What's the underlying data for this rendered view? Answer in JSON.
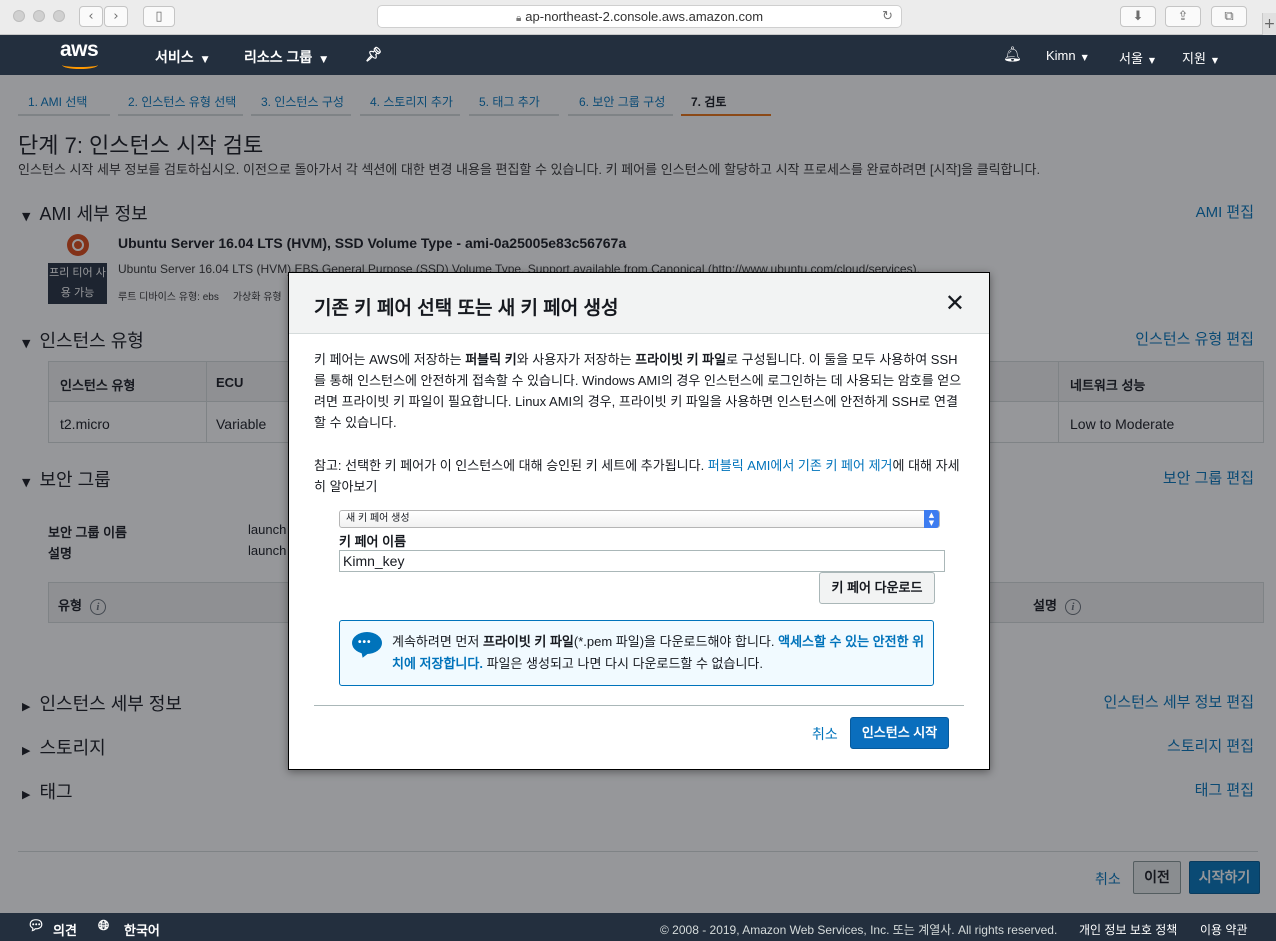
{
  "browser": {
    "url": "ap-northeast-2.console.aws.amazon.com"
  },
  "nav": {
    "logo": "aws",
    "services": "서비스",
    "resource_groups": "리소스 그룹",
    "user": "Kimn",
    "region": "서울",
    "support": "지원"
  },
  "wizard": {
    "tabs": [
      "1. AMI 선택",
      "2. 인스턴스 유형 선택",
      "3. 인스턴스 구성",
      "4. 스토리지 추가",
      "5. 태그 추가",
      "6. 보안 그룹 구성",
      "7. 검토"
    ],
    "active_tab": "7. 검토"
  },
  "page": {
    "title": "단계 7: 인스턴스 시작 검토",
    "description": "인스턴스 시작 세부 정보를 검토하십시오. 이전으로 돌아가서 각 섹션에 대한 변경 내용을 편집할 수 있습니다. 키 페어를 인스턴스에 할당하고 시작 프로세스를 완료하려면 [시작]을 클릭합니다."
  },
  "ami": {
    "heading": "AMI 세부 정보",
    "edit": "AMI 편집",
    "free_badge_1": "프리 티어 사",
    "free_badge_2": "용 가능",
    "title": "Ubuntu Server 16.04 LTS (HVM), SSD Volume Type - ami-0a25005e83c56767a",
    "desc": "Ubuntu Server 16.04 LTS (HVM),EBS General Purpose (SSD) Volume Type. Support available from Canonical (http://www.ubuntu.com/cloud/services).",
    "meta_root": "루트 디바이스 유형: ebs",
    "meta_virt": "가상화 유형"
  },
  "instance_type": {
    "heading": "인스턴스 유형",
    "edit": "인스턴스 유형 편집",
    "col_type": "인스턴스 유형",
    "col_ecu": "ECU",
    "col_network": "네트워크 성능",
    "row_type": "t2.micro",
    "row_ecu": "Variable",
    "row_network": "Low to Moderate"
  },
  "security_group": {
    "heading": "보안 그룹",
    "edit": "보안 그룹 편집",
    "name_label": "보안 그룹 이름",
    "desc_label": "설명",
    "name_value": "launch",
    "desc_value": "launch",
    "col_type": "유형",
    "col_desc": "설명"
  },
  "instance_details": {
    "heading": "인스턴스 세부 정보",
    "edit": "인스턴스 세부 정보 편집"
  },
  "storage": {
    "heading": "스토리지",
    "edit": "스토리지 편집"
  },
  "tags": {
    "heading": "태그",
    "edit": "태그 편집"
  },
  "actions": {
    "cancel": "취소",
    "previous": "이전",
    "launch": "시작하기"
  },
  "footer": {
    "feedback": "의견",
    "language": "한국어",
    "copyright": "© 2008 - 2019, Amazon Web Services, Inc. 또는 계열사. All rights reserved.",
    "privacy": "개인 정보 보호 정책",
    "terms": "이용 약관"
  },
  "modal": {
    "title": "기존 키 페어 선택 또는 새 키 페어 생성",
    "p1_a": "키 페어는 AWS에 저장하는 ",
    "p1_b": "퍼블릭 키",
    "p1_c": "와 사용자가 저장하는 ",
    "p1_d": "프라이빗 키 파일",
    "p1_e": "로 구성됩니다. 이 둘을 모두 사용하여 SSH를 통해 인스턴스에 안전하게 접속할 수 있습니다. Windows AMI의 경우 인스턴스에 로그인하는 데 사용되는 암호를 얻으려면 프라이빗 키 파일이 필요합니다. Linux AMI의 경우, 프라이빗 키 파일을 사용하면 인스턴스에 안전하게 SSH로 연결할 수 있습니다.",
    "p2_a": "참고: 선택한 키 페어가 이 인스턴스에 대해 승인된 키 세트에 추가됩니다. ",
    "p2_link": "퍼블릭 AMI에서 기존 키 페어 제거",
    "p2_b": "에 대해 자세히 알아보기",
    "select_value": "새 키 페어 생성",
    "key_name_label": "키 페어 이름",
    "key_name_value": "Kimn_key",
    "download_button": "키 페어 다운로드",
    "alert_a": "계속하려면 먼저 ",
    "alert_b": "프라이빗 키 파일",
    "alert_c": "(*.pem 파일)을 다운로드해야 합니다. ",
    "alert_d": "액세스할 수 있는 안전한 위치에 저장합니다.",
    "alert_e": " 파일은 생성되고 나면 다시 다운로드할 수 없습니다.",
    "cancel": "취소",
    "launch": "인스턴스 시작"
  }
}
